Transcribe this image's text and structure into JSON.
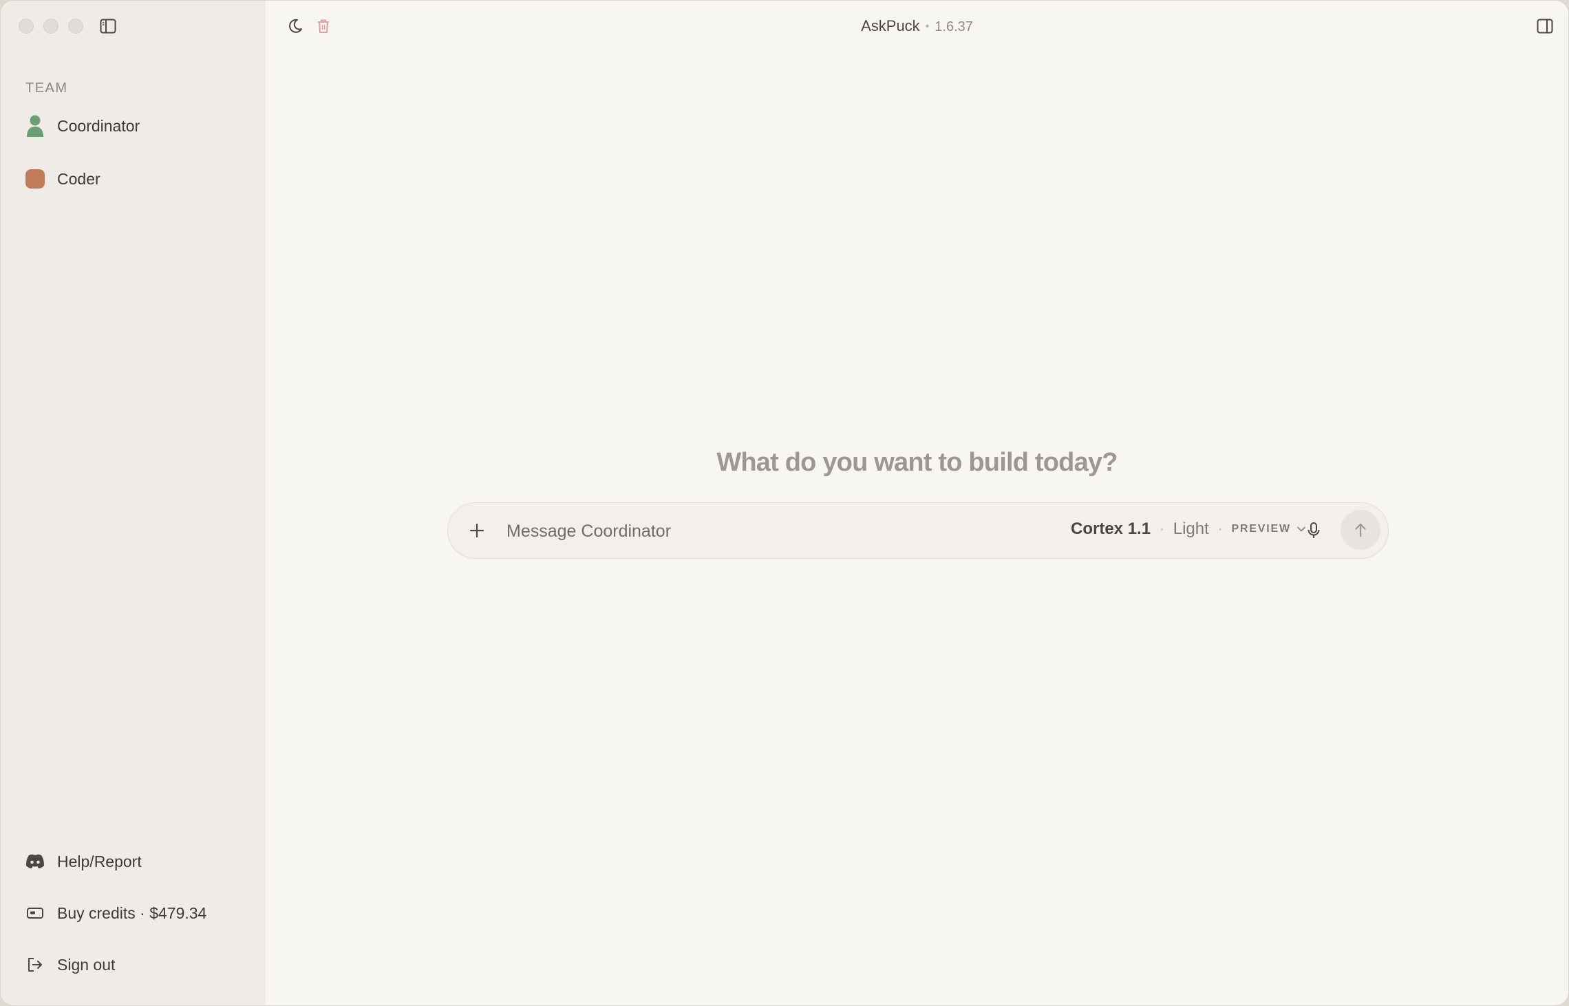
{
  "app": {
    "title": "AskPuck",
    "separator": "•",
    "version": "1.6.37"
  },
  "sidebar": {
    "section_label": "TEAM",
    "team": [
      {
        "label": "Coordinator",
        "icon": "person-icon",
        "color": "#6b9e72"
      },
      {
        "label": "Coder",
        "icon": "rounded-square-icon",
        "color": "#c17b5a"
      }
    ],
    "footer": [
      {
        "label": "Help/Report",
        "icon": "discord-icon"
      },
      {
        "label": "Buy credits · $479.34",
        "icon": "credit-card-icon"
      },
      {
        "label": "Sign out",
        "icon": "sign-out-icon"
      }
    ]
  },
  "main": {
    "prompt": "What do you want to build today?",
    "composer": {
      "placeholder": "Message Coordinator",
      "model": "Cortex 1.1",
      "separator": "·",
      "mode": "Light",
      "badge": "PREVIEW"
    }
  },
  "colors": {
    "sidebar_bg": "#efebe6",
    "main_bg": "#f8f6f2",
    "coordinator": "#6b9e72",
    "coder": "#c17b5a",
    "trash": "#e0a0a0"
  }
}
